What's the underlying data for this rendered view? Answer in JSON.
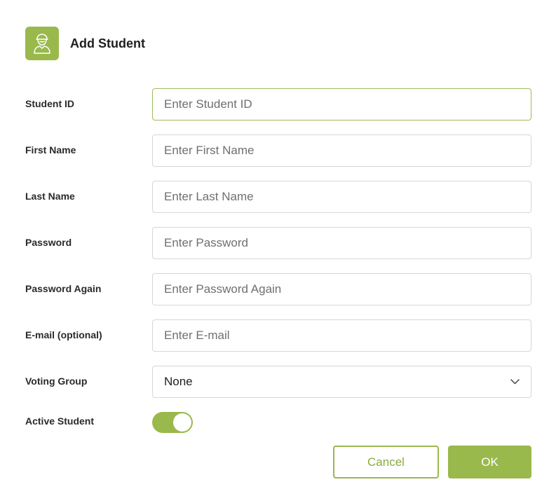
{
  "dialog": {
    "title": "Add Student",
    "header_icon": "student-avatar-icon",
    "accent_color": "#99b94d"
  },
  "fields": [
    {
      "label": "Student ID",
      "placeholder": "Enter Student ID",
      "value": ""
    },
    {
      "label": "First Name",
      "placeholder": "Enter First Name",
      "value": ""
    },
    {
      "label": "Last Name",
      "placeholder": "Enter Last Name",
      "value": ""
    },
    {
      "label": "Password",
      "placeholder": "Enter Password",
      "value": ""
    },
    {
      "label": "Password Again",
      "placeholder": "Enter Password Again",
      "value": ""
    },
    {
      "label": "E-mail (optional)",
      "placeholder": "Enter E-mail",
      "value": ""
    }
  ],
  "voting_group": {
    "label": "Voting Group",
    "selected": "None",
    "icon": "chevron-down-icon"
  },
  "active_student": {
    "label": "Active Student",
    "on": true
  },
  "buttons": {
    "cancel": "Cancel",
    "ok": "OK"
  }
}
